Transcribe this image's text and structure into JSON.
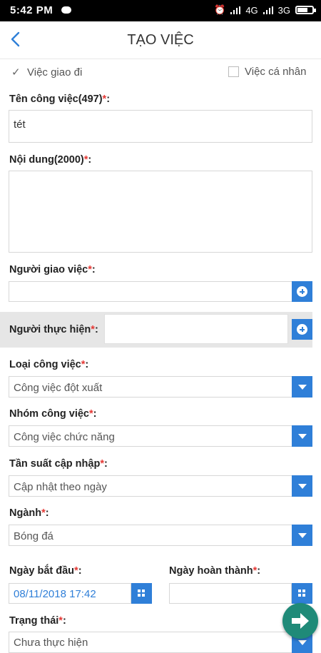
{
  "status": {
    "time": "5:42 PM",
    "network1": "4G",
    "network2": "3G"
  },
  "header": {
    "title": "TẠO VIỆC"
  },
  "options": {
    "assigned": "Việc giao đi",
    "personal": "Việc cá nhân"
  },
  "form": {
    "task_name": {
      "label": "Tên công việc(497)",
      "value": "tét"
    },
    "content": {
      "label": "Nội dung(2000)",
      "value": ""
    },
    "assigner": {
      "label": "Người giao việc",
      "value": ""
    },
    "performer": {
      "label": "Người thực hiện",
      "value": ""
    },
    "task_type": {
      "label": "Loại công việc",
      "value": "Công việc đột xuất"
    },
    "task_group": {
      "label": "Nhóm công việc",
      "value": "Công việc chức năng"
    },
    "frequency": {
      "label": "Tần suất cập nhập",
      "value": "Cập nhật theo ngày"
    },
    "sector": {
      "label": "Ngành",
      "value": "Bóng đá"
    },
    "start_date": {
      "label": "Ngày bắt đầu",
      "value": "08/11/2018 17:42"
    },
    "end_date": {
      "label": "Ngày hoàn thành",
      "value": ""
    },
    "status": {
      "label": "Trạng thái",
      "value": "Chưa thực hiện"
    }
  },
  "required_mark": "*",
  "colors": {
    "accent": "#2f7fd8",
    "fab": "#1f8a78",
    "required": "#e53935"
  }
}
